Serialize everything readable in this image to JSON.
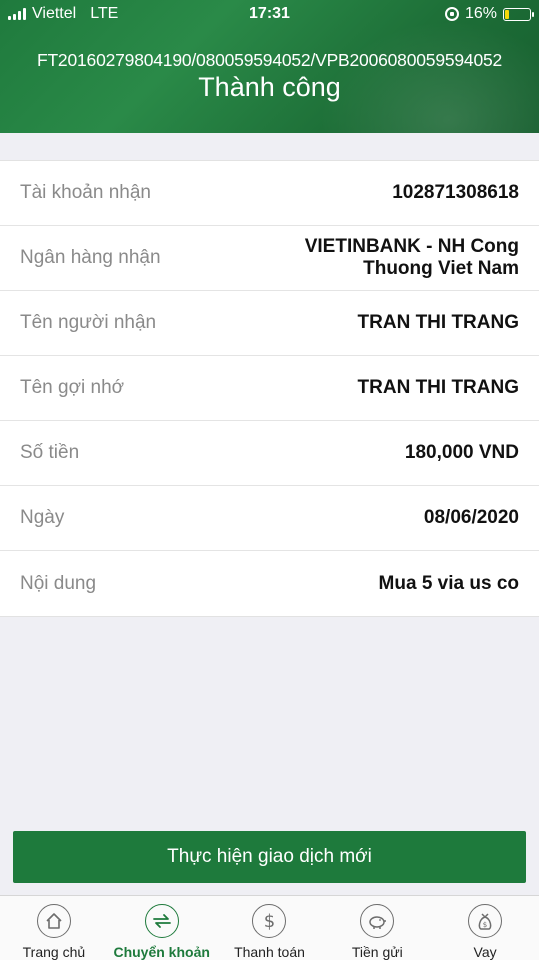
{
  "status_bar": {
    "carrier": "Viettel",
    "network": "LTE",
    "time": "17:31",
    "battery_percent": "16%",
    "battery_level": 0.16
  },
  "header": {
    "reference": "FT20160279804190/080059594052/VPB2006080059594052",
    "title": "Thành công"
  },
  "details": [
    {
      "label": "Tài khoản nhận",
      "value": "102871308618"
    },
    {
      "label": "Ngân hàng nhận",
      "value": "VIETINBANK - NH Cong Thuong Viet Nam"
    },
    {
      "label": "Tên người nhận",
      "value": "TRAN THI TRANG"
    },
    {
      "label": "Tên gợi nhớ",
      "value": "TRAN THI TRANG"
    },
    {
      "label": "Số tiền",
      "value": "180,000 VND"
    },
    {
      "label": "Ngày",
      "value": "08/06/2020"
    },
    {
      "label": "Nội dung",
      "value": "Mua 5 via us co"
    }
  ],
  "action_button": {
    "label": "Thực hiện giao dịch mới"
  },
  "tabs": [
    {
      "label": "Trang chủ",
      "icon": "home-icon",
      "active": false
    },
    {
      "label": "Chuyển khoản",
      "icon": "transfer-icon",
      "active": true
    },
    {
      "label": "Thanh toán",
      "icon": "dollar-icon",
      "active": false
    },
    {
      "label": "Tiền gửi",
      "icon": "piggy-bank-icon",
      "active": false
    },
    {
      "label": "Vay",
      "icon": "money-bag-icon",
      "active": false
    }
  ],
  "colors": {
    "brand_green": "#1e7a3c",
    "battery_fill": "#f5d90a"
  }
}
